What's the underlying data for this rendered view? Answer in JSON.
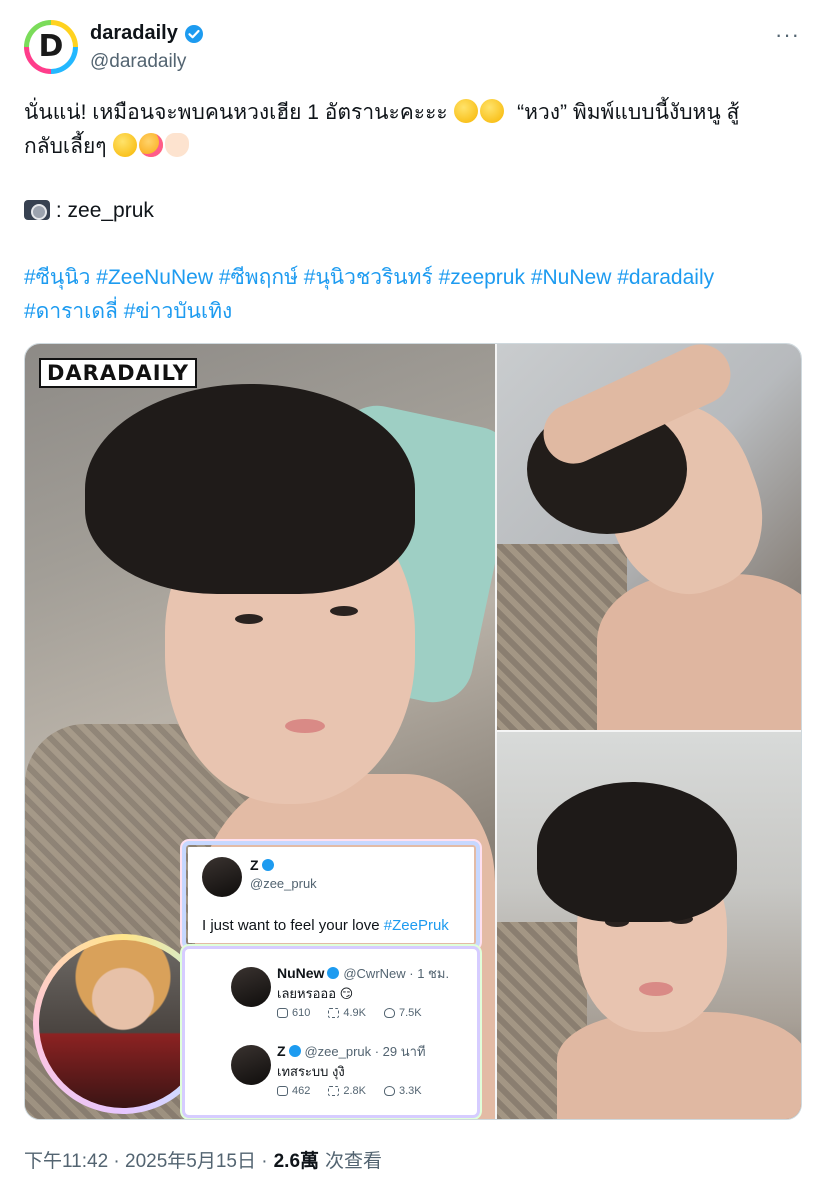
{
  "account": {
    "display_name": "daradaily",
    "handle": "@daradaily",
    "avatar_letter": "D",
    "verified": true
  },
  "more_label": "···",
  "tweet": {
    "line1_a": "นั่นแน่! เหมือนจะพบคนหวงเฮีย 1 อัตรานะคะะะ",
    "line1_b": "“หวง” พิมพ์แบบนี้งับหนู สู้",
    "line2": "กลับเลี้ยๆ",
    "photo_credit": ": zee_pruk",
    "hashtags": [
      "#ซีนุนิว",
      "#ZeeNuNew",
      "#ซีพฤกษ์",
      "#นุนิวชวรินทร์",
      "#zeepruk",
      "#NuNew",
      "#daradaily",
      "#ดาราเดลี่",
      "#ข่าวบันเทิง"
    ]
  },
  "media": {
    "watermark": "DARADAILY",
    "card1": {
      "name": "Z",
      "handle": "@zee_pruk",
      "text_a": "I just want to feel your love ",
      "text_link": "#ZeePruk"
    },
    "card2_reply1": {
      "name": "NuNew",
      "handle": "@CwrNew · 1 ชม.",
      "text": "เลยหรอออ 😏",
      "stats": [
        "610",
        "4.9K",
        "7.5K"
      ]
    },
    "card2_reply2": {
      "name": "Z",
      "handle": "@zee_pruk · 29 นาที",
      "text": "เทสระบบ งุงิ",
      "stats": [
        "462",
        "2.8K",
        "3.3K"
      ]
    }
  },
  "footer": {
    "timestamp": "下午11:42 · 2025年5月15日 ·",
    "views_count": "2.6萬",
    "views_label": "次查看"
  },
  "colors": {
    "link": "#1d9bf0",
    "secondary_text": "#536471",
    "primary_text": "#0f1419"
  }
}
